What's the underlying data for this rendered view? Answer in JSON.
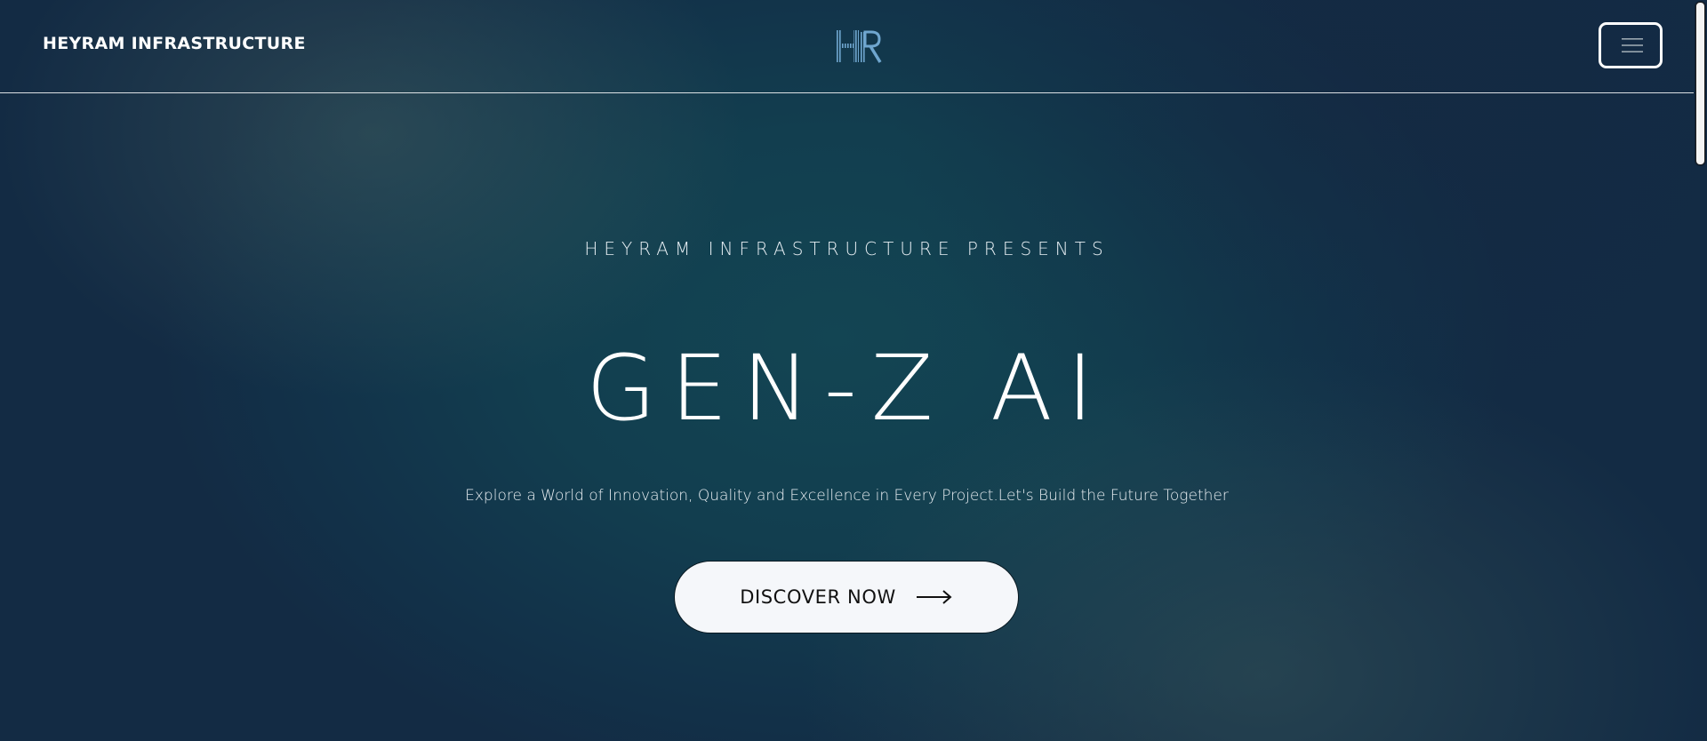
{
  "nav": {
    "brand": "HEYRAM INFRASTRUCTURE",
    "logo_icon": "hr-monogram-logo",
    "menu_icon": "hamburger-menu-icon"
  },
  "hero": {
    "eyebrow": "HEYRAM INFRASTRUCTURE PRESENTS",
    "headline": "GEN-Z AI",
    "tagline": "Explore a World of Innovation, Quality and Excellence in Every Project.Let's Build the Future Together",
    "cta_label": "DISCOVER NOW",
    "cta_icon": "arrow-right-icon"
  },
  "colors": {
    "background": "#134553",
    "text": "#ffffff",
    "cta_background": "#f5f7fa",
    "cta_text": "#111111"
  }
}
